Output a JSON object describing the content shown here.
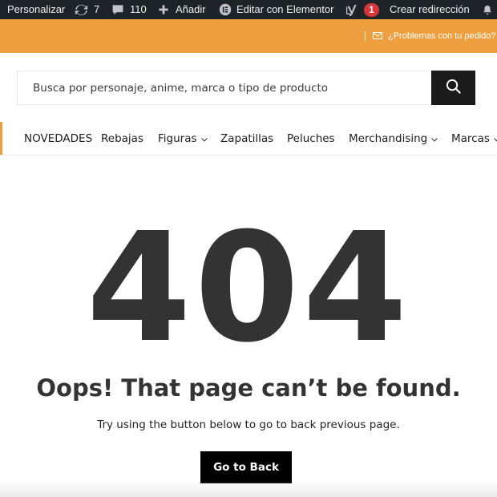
{
  "adminbar": {
    "customize_label": "Personalizar",
    "updates_count": "7",
    "comments_count": "110",
    "add_label": "Añadir",
    "elementor_label": "Editar con Elementor",
    "seo_badge": "1",
    "redirect_label": "Crear redirección"
  },
  "topbar": {
    "help_text": "¿Problemas con tu pedido?"
  },
  "search": {
    "placeholder": "Busca por personaje, anime, marca o tipo de producto"
  },
  "nav": {
    "items": [
      {
        "label": "NOVEDADES"
      },
      {
        "label": "Rebajas"
      },
      {
        "label": "Figuras"
      },
      {
        "label": "Zapatillas"
      },
      {
        "label": "Peluches"
      },
      {
        "label": "Merchandising"
      },
      {
        "label": "Marcas"
      }
    ]
  },
  "error": {
    "code": "404",
    "heading": "Oops! That page can’t be found.",
    "message": "Try using the button below to go to back previous page.",
    "button_label": "Go to Back"
  },
  "colors": {
    "accent": "#eea040",
    "admin_bar": "#1d2327",
    "badge": "#d63638",
    "button": "#000000",
    "heading": "#333333"
  },
  "icons": [
    "refresh-icon",
    "comment-icon",
    "plus-icon",
    "elementor-icon",
    "yoast-icon",
    "bell-icon",
    "mail-icon",
    "search-icon",
    "chevron-down-icon"
  ]
}
